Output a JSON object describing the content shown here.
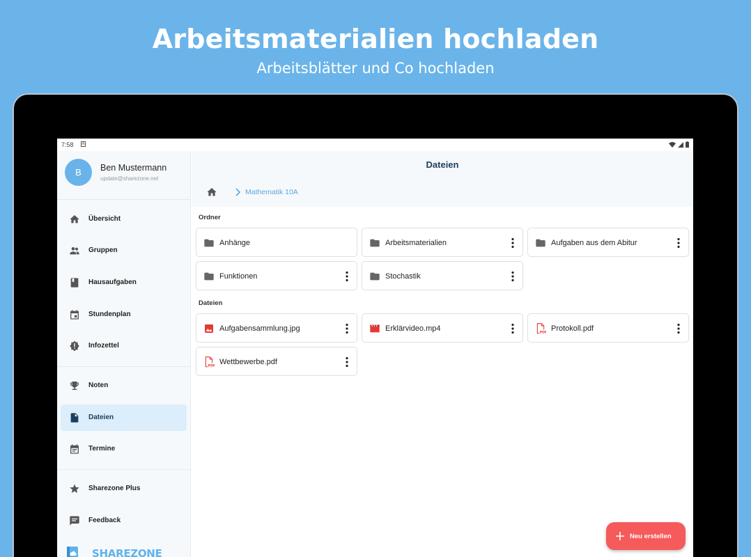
{
  "promo": {
    "title": "Arbeitsmaterialien hochladen",
    "subtitle": "Arbeitsblätter und Co hochladen"
  },
  "statusbar": {
    "time": "7:58"
  },
  "profile": {
    "initial": "B",
    "name": "Ben Mustermann",
    "email": "update@sharezone.net"
  },
  "sidebar": {
    "items": [
      {
        "label": "Übersicht",
        "icon": "home-icon"
      },
      {
        "label": "Gruppen",
        "icon": "group-icon"
      },
      {
        "label": "Hausaufgaben",
        "icon": "book-icon"
      },
      {
        "label": "Stundenplan",
        "icon": "calendar-icon"
      },
      {
        "label": "Infozettel",
        "icon": "info-badge-icon"
      },
      {
        "label": "Noten",
        "icon": "trophy-icon"
      },
      {
        "label": "Dateien",
        "icon": "file-icon",
        "active": true
      },
      {
        "label": "Termine",
        "icon": "event-icon"
      },
      {
        "label": "Sharezone Plus",
        "icon": "star-icon"
      },
      {
        "label": "Feedback",
        "icon": "feedback-icon"
      }
    ],
    "brand": "SHAREZONE"
  },
  "main": {
    "title": "Dateien",
    "breadcrumb": "Mathematik 10A",
    "folders_heading": "Ordner",
    "files_heading": "Dateien",
    "folders": [
      {
        "name": "Anhänge",
        "has_menu": false
      },
      {
        "name": "Arbeitsmaterialien",
        "has_menu": true
      },
      {
        "name": "Aufgaben aus dem Abitur",
        "has_menu": true
      },
      {
        "name": "Funktionen",
        "has_menu": true
      },
      {
        "name": "Stochastik",
        "has_menu": true
      }
    ],
    "files": [
      {
        "name": "Aufgabensammlung.jpg",
        "icon": "image-icon"
      },
      {
        "name": "Erklärvideo.mp4",
        "icon": "video-icon"
      },
      {
        "name": "Protokoll.pdf",
        "icon": "pdf-icon"
      },
      {
        "name": "Wettbewerbe.pdf",
        "icon": "pdf-icon"
      }
    ],
    "fab_label": "Neu erstellen"
  },
  "colors": {
    "background": "#6ab4ea",
    "accent": "#5fb3ea",
    "fab": "#f55b5b",
    "active_nav": "#dcedfb",
    "title": "#1c3e5e"
  }
}
